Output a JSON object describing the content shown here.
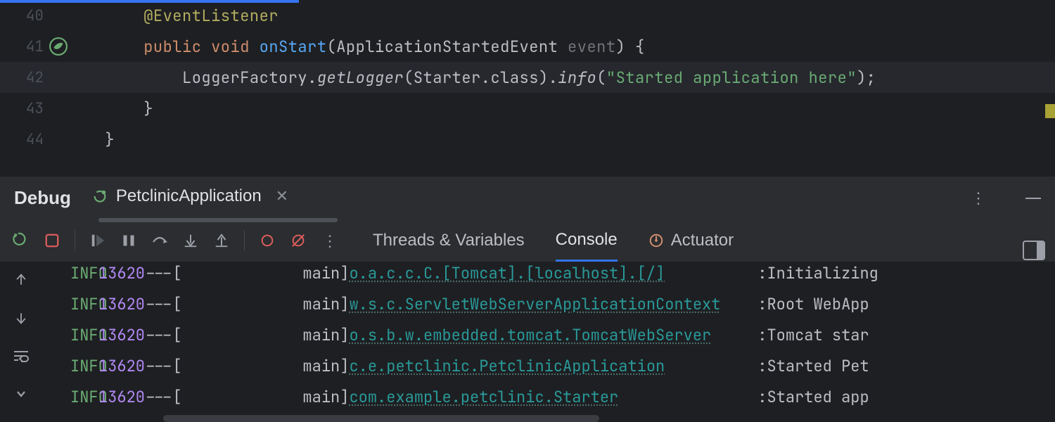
{
  "editor": {
    "lines": [
      {
        "num": "40"
      },
      {
        "num": "41"
      },
      {
        "num": "42"
      },
      {
        "num": "43"
      },
      {
        "num": "44"
      }
    ],
    "code": {
      "annotation": "@EventListener",
      "kw_public": "public",
      "kw_void": "void",
      "fn_name": "onStart",
      "param_type": "ApplicationStartedEvent",
      "param_name": "event",
      "open_brace": " {",
      "logger_factory": "LoggerFactory",
      "get_logger": "getLogger",
      "starter_class": "Starter",
      "dot_class": ".class",
      "info_call": "info",
      "string_lit": "\"Started application here\"",
      "close1": "}",
      "close2": "}"
    }
  },
  "debug_panel": {
    "title": "Debug",
    "run_config": "PetclinicApplication"
  },
  "tabs": {
    "threads": "Threads & Variables",
    "console": "Console",
    "actuator": "Actuator"
  },
  "console": {
    "lines": [
      {
        "level": "INFO",
        "pid": "13620",
        "dash": "---",
        "thread_pad": "[             main]",
        "logger": "o.a.c.c.C.[Tomcat].[localhost].[/]",
        "logger_dot": true,
        "msg": "Initializing"
      },
      {
        "level": "INFO",
        "pid": "13620",
        "dash": "---",
        "thread_pad": "[             main]",
        "logger": "w.s.c.ServletWebServerApplicationContext",
        "logger_dot": true,
        "msg": "Root WebApp"
      },
      {
        "level": "INFO",
        "pid": "13620",
        "dash": "---",
        "thread_pad": "[             main]",
        "logger": "o.s.b.w.embedded.tomcat.TomcatWebServer",
        "logger_dot": true,
        "msg": "Tomcat star"
      },
      {
        "level": "INFO",
        "pid": "13620",
        "dash": "---",
        "thread_pad": "[             main]",
        "logger": "c.e.petclinic.PetclinicApplication",
        "logger_dot": true,
        "msg": "Started Pet"
      },
      {
        "level": "INFO",
        "pid": "13620",
        "dash": "---",
        "thread_pad": "[             main]",
        "logger": "com.example.petclinic.Starter",
        "logger_dot": true,
        "msg": "Started app"
      }
    ]
  }
}
